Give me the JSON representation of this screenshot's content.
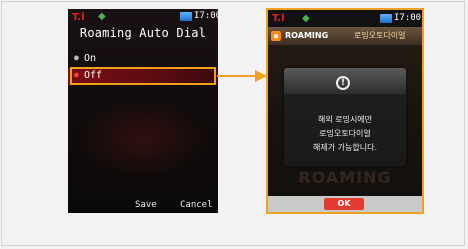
{
  "left_phone": {
    "status": {
      "signal": "T.l",
      "time": "I7:00"
    },
    "title": "Roaming Auto Dial",
    "options": [
      {
        "label": "On",
        "selected": false
      },
      {
        "label": "Off",
        "selected": true
      }
    ],
    "softkeys": {
      "left": "Save",
      "right": "Cancel"
    }
  },
  "right_phone": {
    "status": {
      "signal": "T.l",
      "time": "I7:00"
    },
    "header": {
      "title_en": "ROAMING",
      "title_ko": "로밍오토다이얼"
    },
    "dialog": {
      "lines": [
        "해외 로밍시에만",
        "로밍오토다이얼",
        "해제가 가능합니다."
      ]
    },
    "background_text": "ROAMING",
    "ok_label": "OK"
  },
  "icons": {
    "speaker": "speaker-icon",
    "battery": "battery-icon",
    "info": "info-icon",
    "arrow": "arrow-right-icon"
  },
  "colors": {
    "highlight": "#f0a020",
    "selected_row": "#7a0f14",
    "ok_button": "#e53b2e"
  }
}
